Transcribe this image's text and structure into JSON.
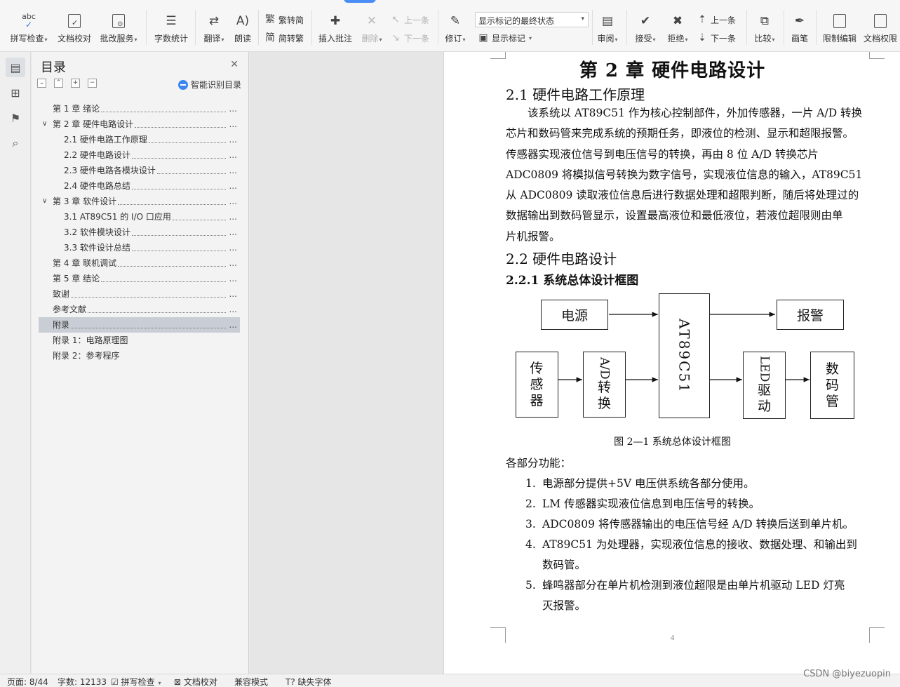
{
  "ribbon": {
    "tools": [
      {
        "label": "拼写检查",
        "dropdown": true
      },
      {
        "label": "文档校对"
      },
      {
        "label": "批改服务",
        "dropdown": true
      },
      {
        "label": "字数统计"
      },
      {
        "label": "翻译",
        "dropdown": true
      },
      {
        "label": "朗读"
      },
      {
        "label": "繁转简"
      },
      {
        "label": "简转繁"
      },
      {
        "label": "插入批注"
      },
      {
        "label": "删除",
        "dropdown": true,
        "disabled": true
      },
      {
        "label": "上一条",
        "disabled": true
      },
      {
        "label": "下一条",
        "disabled": true
      },
      {
        "label": "修订",
        "dropdown": true
      },
      {
        "label": "显示标记",
        "dropdown": true
      },
      {
        "label": "审阅",
        "dropdown": true
      },
      {
        "label": "接受",
        "dropdown": true
      },
      {
        "label": "拒绝",
        "dropdown": true
      },
      {
        "label": "上一条"
      },
      {
        "label": "下一条"
      },
      {
        "label": "比较",
        "dropdown": true
      },
      {
        "label": "画笔"
      },
      {
        "label": "限制编辑"
      },
      {
        "label": "文档权限"
      }
    ],
    "markup_select_value": "显示标记的最终状态"
  },
  "toc": {
    "title": "目录",
    "smart_label": "智能识别目录",
    "items": [
      {
        "text": "第 1 章  绪论",
        "level": 1,
        "toggle": "",
        "selected": false
      },
      {
        "text": "第 2 章  硬件电路设计",
        "level": 1,
        "toggle": "v",
        "selected": false
      },
      {
        "text": "2.1  硬件电路工作原理",
        "level": 2,
        "toggle": "",
        "selected": false
      },
      {
        "text": "2.2  硬件电路设计",
        "level": 2,
        "toggle": "",
        "selected": false
      },
      {
        "text": "2.3  硬件电路各模块设计",
        "level": 2,
        "toggle": "",
        "selected": false
      },
      {
        "text": "2.4  硬件电路总结",
        "level": 2,
        "toggle": "",
        "selected": false
      },
      {
        "text": "第 3 章  软件设计",
        "level": 1,
        "toggle": "v",
        "selected": false
      },
      {
        "text": "3.1  AT89C51 的 I/O 口应用",
        "level": 2,
        "toggle": "",
        "selected": false
      },
      {
        "text": "3.2  软件模块设计",
        "level": 2,
        "toggle": "",
        "selected": false
      },
      {
        "text": "3.3  软件设计总结",
        "level": 2,
        "toggle": "",
        "selected": false
      },
      {
        "text": "第 4 章  联机调试",
        "level": 1,
        "toggle": "",
        "selected": false
      },
      {
        "text": "第 5 章  结论",
        "level": 1,
        "toggle": "",
        "selected": false
      },
      {
        "text": "致谢",
        "level": 1,
        "toggle": "",
        "selected": false
      },
      {
        "text": "参考文献",
        "level": 1,
        "toggle": "",
        "selected": false
      },
      {
        "text": "附录",
        "level": 1,
        "toggle": "",
        "selected": true
      },
      {
        "text": "附录 1：电路原理图",
        "level": 1,
        "toggle": "",
        "selected": false,
        "noleader": true
      },
      {
        "text": "附录 2：参考程序",
        "level": 1,
        "toggle": "",
        "selected": false,
        "noleader": true
      }
    ],
    "ellipsis": "..."
  },
  "document": {
    "chapter_title": "第 2 章    硬件电路设计",
    "sec_2_1": "2.1    硬件电路工作原理",
    "para_lines": [
      "　　该系统以 AT89C51 作为核心控制部件，外加传感器，一片 A/D 转换",
      "芯片和数码管来完成系统的预期任务，即液位的检测、显示和超限报警。",
      "传感器实现液位信号到电压信号的转换，再由 8 位 A/D 转换芯片",
      "ADC0809 将模拟信号转换为数字信号，实现液位信息的输入，AT89C51",
      "从 ADC0809 读取液位信息后进行数据处理和超限判断，随后将处理过的",
      "数据输出到数码管显示，设置最高液位和最低液位，若液位超限则由单",
      "片机报警。"
    ],
    "sec_2_2": "2.2    硬件电路设计",
    "sec_2_2_1": "2.2.1    系统总体设计框图",
    "diagram": {
      "power": "电源",
      "alarm": "报警",
      "sensor": "传感器",
      "adc": "A/D转换",
      "adc_line1": "A/D",
      "adc_line2": "转换",
      "mcu": "AT89C51",
      "led_driver": "LED驱动",
      "led_line1": "LED",
      "led_line2": "驱动",
      "display": "数码管"
    },
    "figure_caption": "图 2—1  系统总体设计框图",
    "parts_intro": "各部分功能：",
    "list": [
      {
        "num": "1.",
        "lines": [
          "电源部分提供+5V 电压供系统各部分使用。"
        ]
      },
      {
        "num": "2.",
        "lines": [
          "LM 传感器实现液位信息到电压信号的转换。"
        ]
      },
      {
        "num": "3.",
        "lines": [
          "ADC0809 将传感器输出的电压信号经 A/D 转换后送到单片机。"
        ]
      },
      {
        "num": "4.",
        "lines": [
          "AT89C51 为处理器，实现液位信息的接收、数据处理、和输出到",
          "数码管。"
        ]
      },
      {
        "num": "5.",
        "lines": [
          "蜂鸣器部分在单片机检测到液位超限是由单片机驱动 LED 灯亮",
          "灭报警。"
        ]
      }
    ],
    "page_number": "4"
  },
  "status": {
    "page": "页面: 8/44",
    "words": "字数: 12133",
    "spellcheck": "拼写检查",
    "proof": "文档校对",
    "compat": "兼容模式",
    "missing_font": "缺失字体"
  },
  "watermark": "CSDN @biyezuopin"
}
